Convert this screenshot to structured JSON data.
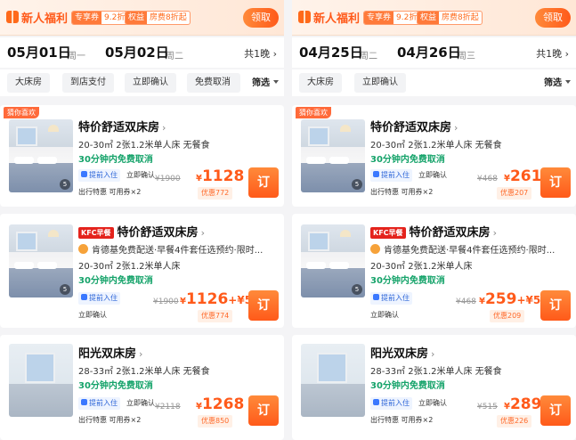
{
  "left": {
    "banner": {
      "title": "新人福利",
      "tag1_k": "专享券",
      "tag1_v": "9.2折",
      "tag2_k": "权益",
      "tag2_v": "房费8折起",
      "claim": "领取"
    },
    "dates": {
      "checkin": "05月01日",
      "checkin_wd": "周一",
      "checkout": "05月02日",
      "checkout_wd": "周二",
      "nights": "共1晚 ›"
    },
    "filters": {
      "chips": [
        "大床房",
        "到店支付",
        "立即确认",
        "免费取消"
      ],
      "select": "筛选"
    },
    "cards": [
      {
        "ribbon": "猜你喜欢",
        "room": "特价舒适双床房",
        "arrow": "›",
        "spec": "20-30㎡  2张1.2米单人床  无餐食",
        "cancel": "30分钟内免费取消",
        "b1": "提前入住",
        "b2": "立即确认",
        "b3": "出行特惠   可用券×2",
        "orig": "¥1900",
        "price_y": "¥",
        "price": "1128",
        "plus": "",
        "disc": "优惠772",
        "book": "订",
        "photo_count": "5"
      },
      {
        "kfc": "KFC早餐",
        "room": "特价舒适双床房",
        "arrow": "›",
        "promo": "肯德基免费配送·早餐4件套任选预约·限时...",
        "spec": "20-30㎡  2张1.2米单人床",
        "cancel": "30分钟内免费取消",
        "b1": "提前入住",
        "b3": "立即确认",
        "orig": "¥1900",
        "price_y": "¥",
        "price": "1126",
        "plus": "+¥52",
        "disc": "优惠774",
        "book": "订",
        "photo_count": "5"
      },
      {
        "room": "阳光双床房",
        "arrow": "›",
        "spec": "28-33㎡  2张1.2米单人床  无餐食",
        "cancel": "30分钟内免费取消",
        "b1": "提前入住",
        "b2": "立即确认",
        "b3": "出行特惠   可用券×2",
        "orig": "¥2118",
        "price_y": "¥",
        "price": "1268",
        "plus": "",
        "disc": "优惠850",
        "book": "订"
      }
    ]
  },
  "right": {
    "banner": {
      "title": "新人福利",
      "tag1_k": "专享券",
      "tag1_v": "9.2折",
      "tag2_k": "权益",
      "tag2_v": "房费8折起",
      "claim": "领取"
    },
    "dates": {
      "checkin": "04月25日",
      "checkin_wd": "周二",
      "checkout": "04月26日",
      "checkout_wd": "周三",
      "nights": "共1晚 ›"
    },
    "filters": {
      "chips": [
        "大床房",
        "立即确认"
      ],
      "select": "筛选"
    },
    "cards": [
      {
        "ribbon": "猜你喜欢",
        "room": "特价舒适双床房",
        "arrow": "›",
        "spec": "20-30㎡  2张1.2米单人床  无餐食",
        "cancel": "30分钟内免费取消",
        "b1": "提前入住",
        "b2": "立即确认",
        "b3": "出行特惠   可用券×2",
        "orig": "¥468",
        "price_y": "¥",
        "price": "261",
        "plus": "",
        "disc": "优惠207",
        "book": "订",
        "photo_count": "5"
      },
      {
        "kfc": "KFC早餐",
        "room": "特价舒适双床房",
        "arrow": "›",
        "promo": "肯德基免费配送·早餐4件套任选预约·限时...",
        "spec": "20-30㎡  2张1.2米单人床",
        "cancel": "30分钟内免费取消",
        "b1": "提前入住",
        "b3": "立即确认",
        "orig": "¥468",
        "price_y": "¥",
        "price": "259",
        "plus": "+¥52",
        "disc": "优惠209",
        "book": "订",
        "photo_count": "5"
      },
      {
        "room": "阳光双床房",
        "arrow": "›",
        "spec": "28-33㎡  2张1.2米单人床  无餐食",
        "cancel": "30分钟内免费取消",
        "b1": "提前入住",
        "b2": "立即确认",
        "b3": "出行特惠   可用券×2",
        "orig": "¥515",
        "price_y": "¥",
        "price": "289",
        "plus": "",
        "disc": "优惠226",
        "book": "订"
      }
    ]
  }
}
